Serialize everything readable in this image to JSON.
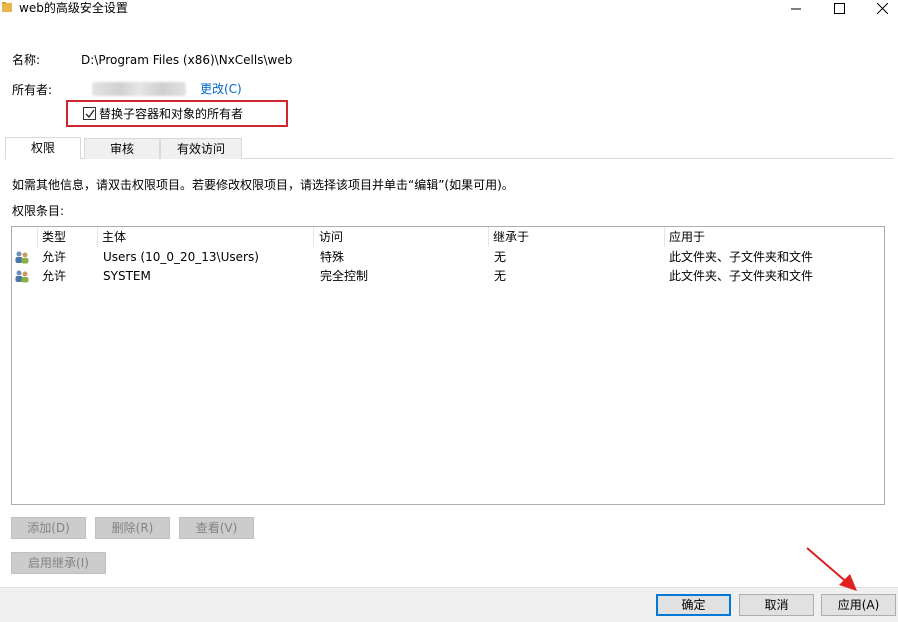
{
  "window": {
    "title": "web的高级安全设置",
    "icon": "folder-icon",
    "controls": [
      "minimize-icon",
      "maximize-icon",
      "close-icon"
    ]
  },
  "name_row": {
    "label": "名称:",
    "value": "D:\\Program Files (x86)\\NxCells\\web"
  },
  "owner_row": {
    "label": "所有者:",
    "change_link": "更改(C)"
  },
  "replace_owner": {
    "label": "替换子容器和对象的所有者",
    "checked": true
  },
  "tabs": [
    {
      "label": "权限",
      "active": true
    },
    {
      "label": "审核",
      "active": false
    },
    {
      "label": "有效访问",
      "active": false
    }
  ],
  "info_text": "如需其他信息，请双击权限项目。若要修改权限项目，请选择该项目并单击“编辑”(如果可用)。",
  "entries_label": "权限条目:",
  "table": {
    "columns": [
      "类型",
      "主体",
      "访问",
      "继承于",
      "应用于"
    ],
    "rows": [
      {
        "type": "允许",
        "principal": "Users (10_0_20_13\\Users)",
        "access": "特殊",
        "inherited": "无",
        "applies": "此文件夹、子文件夹和文件"
      },
      {
        "type": "允许",
        "principal": "SYSTEM",
        "access": "完全控制",
        "inherited": "无",
        "applies": "此文件夹、子文件夹和文件"
      }
    ]
  },
  "actions": {
    "add": "添加(D)",
    "remove": "删除(R)",
    "view": "查看(V)",
    "enable_inheritance": "启用继承(I)"
  },
  "footer": {
    "ok": "确定",
    "cancel": "取消",
    "apply": "应用(A)"
  },
  "colors": {
    "highlight_box": "#d0262d",
    "annotation_arrow": "#e02020",
    "link": "#0066cc",
    "focus": "#0078d7"
  }
}
